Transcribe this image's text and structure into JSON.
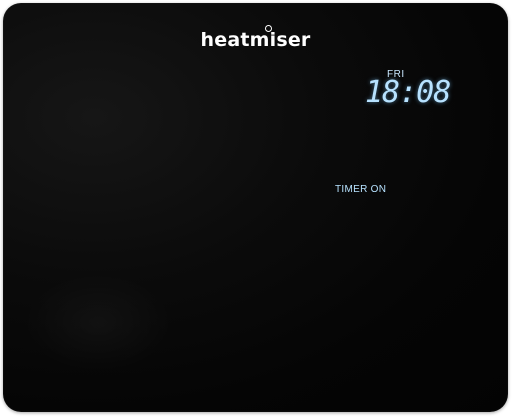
{
  "device": {
    "brand": "heatmiser",
    "display": {
      "day": "FRI",
      "time": "18:08",
      "status": "TIMER ON"
    },
    "colors": {
      "body": "#050505",
      "lcd_text": "#b7e2ff",
      "brand_text": "#ffffff"
    }
  }
}
